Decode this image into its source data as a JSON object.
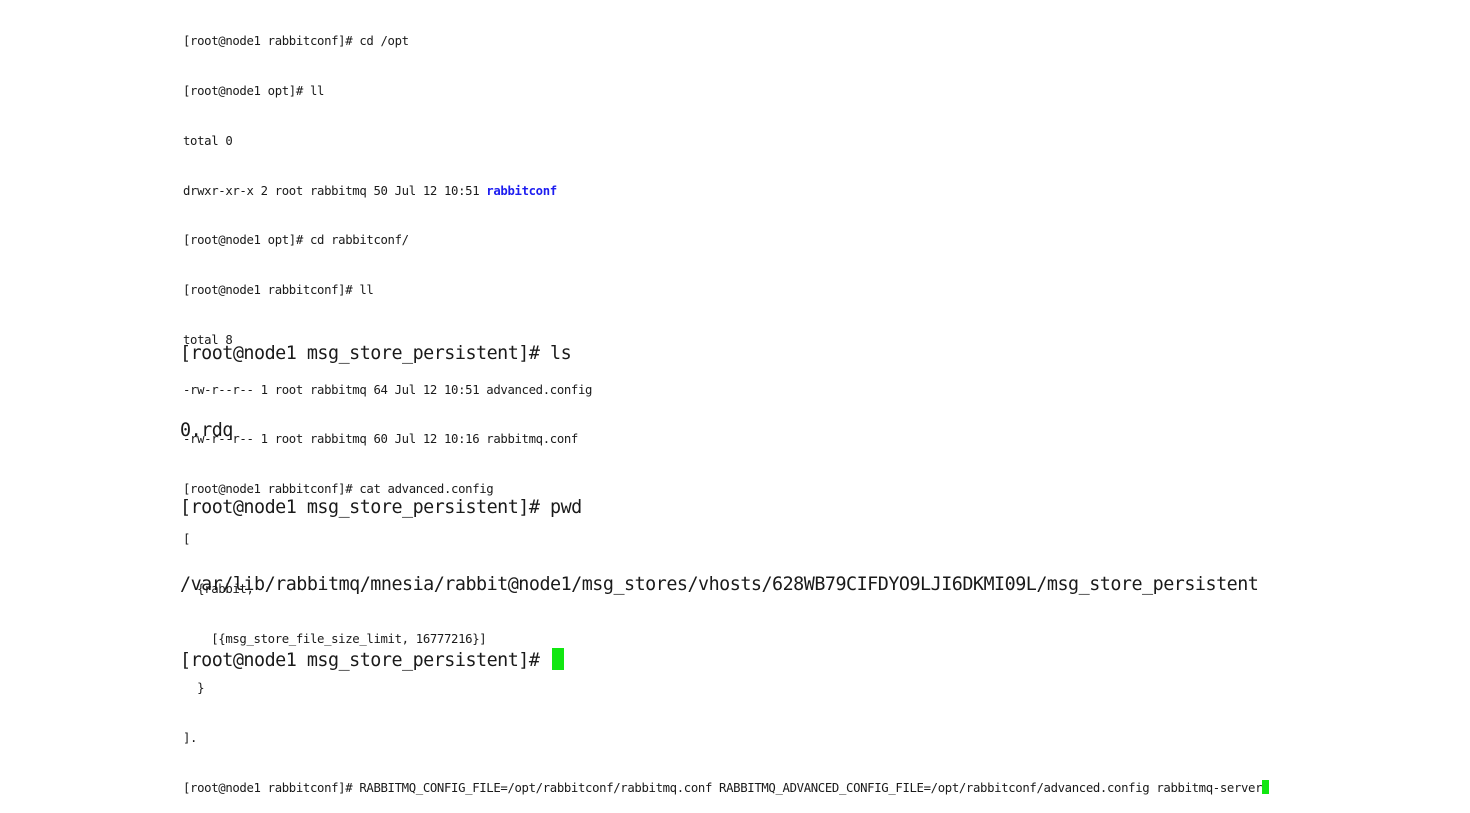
{
  "terminal_top": {
    "lines": [
      "[root@node1 rabbitconf]# cd /opt",
      "[root@node1 opt]# ll",
      "total 0",
      "drwxr-xr-x 2 root rabbitmq 50 Jul 12 10:51 ",
      "[root@node1 opt]# cd rabbitconf/",
      "[root@node1 rabbitconf]# ll",
      "total 8",
      "-rw-r--r-- 1 root rabbitmq 64 Jul 12 10:51 advanced.config",
      "-rw-r--r-- 1 root rabbitmq 60 Jul 12 10:16 rabbitmq.conf",
      "[root@node1 rabbitconf]# cat advanced.config",
      "[",
      "  {rabbit,",
      "    [{msg_store_file_size_limit, 16777216}]",
      "  }",
      "].",
      "[root@node1 rabbitconf]# RABBITMQ_CONFIG_FILE=/opt/rabbitconf/rabbitmq.conf RABBITMQ_ADVANCED_CONFIG_FILE=/opt/rabbitconf/advanced.config rabbitmq-server"
    ],
    "dir_name": "rabbitconf"
  },
  "terminal_bottom": {
    "lines": [
      "[root@node1 msg_store_persistent]# ls",
      "0.rdq",
      "[root@node1 msg_store_persistent]# pwd",
      "/var/lib/rabbitmq/mnesia/rabbit@node1/msg_stores/vhosts/628WB79CIFDYO9LJI6DKMI09L/msg_store_persistent",
      "[root@node1 msg_store_persistent]# "
    ]
  },
  "colors": {
    "background": "#ffffff",
    "text": "#1a1a1a",
    "directory": "#1d1df0",
    "cursor": "#11e711"
  }
}
